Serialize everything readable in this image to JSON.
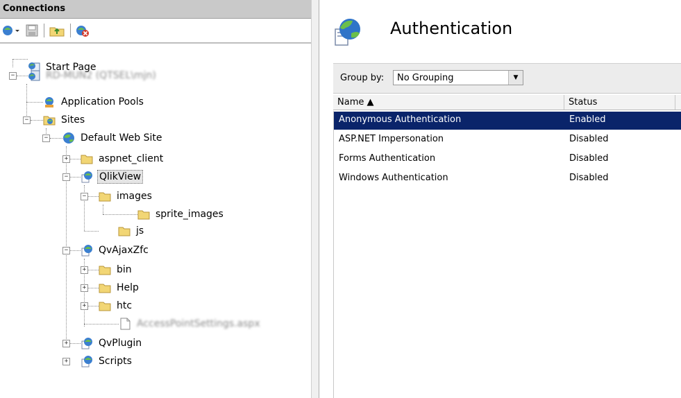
{
  "connections": {
    "header": "Connections",
    "toolbar": [
      "connect-icon",
      "save-icon",
      "up-folder-icon",
      "disconnect-icon"
    ]
  },
  "tree": {
    "start_page": "Start Page",
    "server": "RD-MUN2 (QTSEL\\mjn)",
    "app_pools": "Application Pools",
    "sites": "Sites",
    "default_site": "Default Web Site",
    "aspnet_client": "aspnet_client",
    "qlikview": "QlikView",
    "images": "images",
    "sprite_images": "sprite_images",
    "js": "js",
    "qvajaxzfc": "QvAjaxZfc",
    "bin": "bin",
    "help": "Help",
    "htc": "htc",
    "accesspoint_file": "AccessPointSettings.aspx",
    "qvplugin": "QvPlugin",
    "scripts": "Scripts"
  },
  "feature": {
    "title": "Authentication",
    "group_by_label": "Group by:",
    "group_by_value": "No Grouping",
    "columns": {
      "name": "Name ▲",
      "status": "Status"
    },
    "rows": [
      {
        "name": "Anonymous Authentication",
        "status": "Enabled"
      },
      {
        "name": "ASP.NET Impersonation",
        "status": "Disabled"
      },
      {
        "name": "Forms Authentication",
        "status": "Disabled"
      },
      {
        "name": "Windows Authentication",
        "status": "Disabled"
      }
    ]
  },
  "colors": {
    "selection": "#0a246a",
    "header_gray": "#c9c9c9",
    "folder": "#f2d675"
  }
}
